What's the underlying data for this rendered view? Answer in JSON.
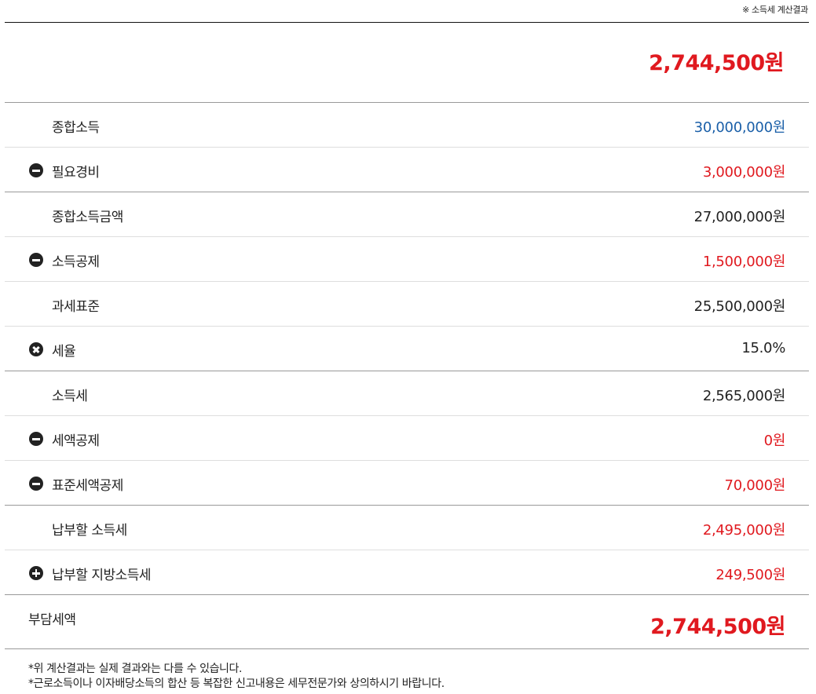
{
  "header": {
    "caption": "※ 소득세 계산결과"
  },
  "summary": {
    "total": "2,744,500원",
    "total_color": "#e0191f"
  },
  "colors": {
    "blue": "#1a5fa8",
    "red": "#e0191f",
    "dark": "#222222"
  },
  "rows": [
    {
      "label": "종합소득",
      "value": "30,000,000원",
      "icon": null,
      "color": "blue"
    },
    {
      "label": "필요경비",
      "value": "3,000,000원",
      "icon": "minus-circle-icon",
      "color": "red"
    },
    {
      "label": "종합소득금액",
      "value": "27,000,000원",
      "icon": null,
      "color": "dark"
    },
    {
      "label": "소득공제",
      "value": "1,500,000원",
      "icon": "minus-circle-icon",
      "color": "red"
    },
    {
      "label": "과세표준",
      "value": "25,500,000원",
      "icon": null,
      "color": "dark"
    },
    {
      "label": "세율",
      "value": "15.0%",
      "icon": "times-circle-icon",
      "color": "dark"
    },
    {
      "label": "소득세",
      "value": "2,565,000원",
      "icon": null,
      "color": "dark"
    },
    {
      "label": "세액공제",
      "value": "0원",
      "icon": "minus-circle-icon",
      "color": "red"
    },
    {
      "label": "표준세액공제",
      "value": "70,000원",
      "icon": "minus-circle-icon",
      "color": "red"
    },
    {
      "label": "납부할 소득세",
      "value": "2,495,000원",
      "icon": null,
      "color": "red"
    },
    {
      "label": "납부할 지방소득세",
      "value": "249,500원",
      "icon": "plus-circle-icon",
      "color": "red"
    }
  ],
  "final": {
    "label": "부담세액",
    "value": "2,744,500원"
  },
  "notes": [
    "*위 계산결과는 실제 결과와는 다를 수 있습니다.",
    "*근로소득이나 이자배당소득의 합산 등 복잡한 신고내용은 세무전문가와 상의하시기 바랍니다."
  ]
}
